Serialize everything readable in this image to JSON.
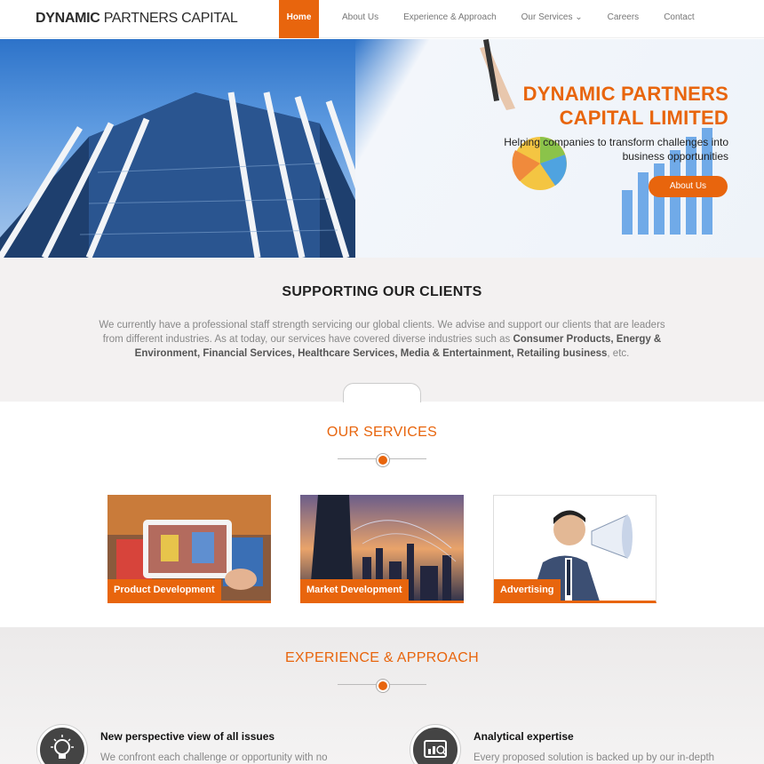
{
  "header": {
    "logo_bold": "DYNAMIC",
    "logo_rest": " PARTNERS CAPITAL",
    "nav": [
      {
        "label": "Home",
        "active": true
      },
      {
        "label": "About Us"
      },
      {
        "label": "Experience & Approach"
      },
      {
        "label": "Our Services ⌄"
      },
      {
        "label": "Careers"
      },
      {
        "label": "Contact"
      }
    ]
  },
  "hero": {
    "title_line1": "DYNAMIC PARTNERS",
    "title_line2": "CAPITAL LIMITED",
    "subtitle_line1": "Helping companies to transform challenges into",
    "subtitle_line2": "business opportunities",
    "button": "About Us"
  },
  "support": {
    "title": "SUPPORTING OUR CLIENTS",
    "text_before": "We currently have a professional staff strength servicing our global clients. We advise and support our clients that are leaders from different industries. As at today, our services have covered diverse industries such as ",
    "industries": "Consumer Products, Energy & Environment, Financial Services, Healthcare Services, Media & Entertainment, Retailing business",
    "text_after": ", etc."
  },
  "services": {
    "title": "OUR SERVICES",
    "cards": [
      {
        "label": "Product Development"
      },
      {
        "label": "Market Development"
      },
      {
        "label": "Advertising"
      }
    ]
  },
  "experience": {
    "title": "EXPERIENCE & APPROACH",
    "features": [
      {
        "title": "New perspective view of all issues",
        "text": "We confront each challenge or opportunity with no",
        "icon": "lightbulb-icon"
      },
      {
        "title": "Analytical expertise",
        "text": "Every proposed solution is backed up by our in-depth",
        "icon": "analytics-icon"
      }
    ]
  },
  "colors": {
    "accent": "#e8650d"
  }
}
